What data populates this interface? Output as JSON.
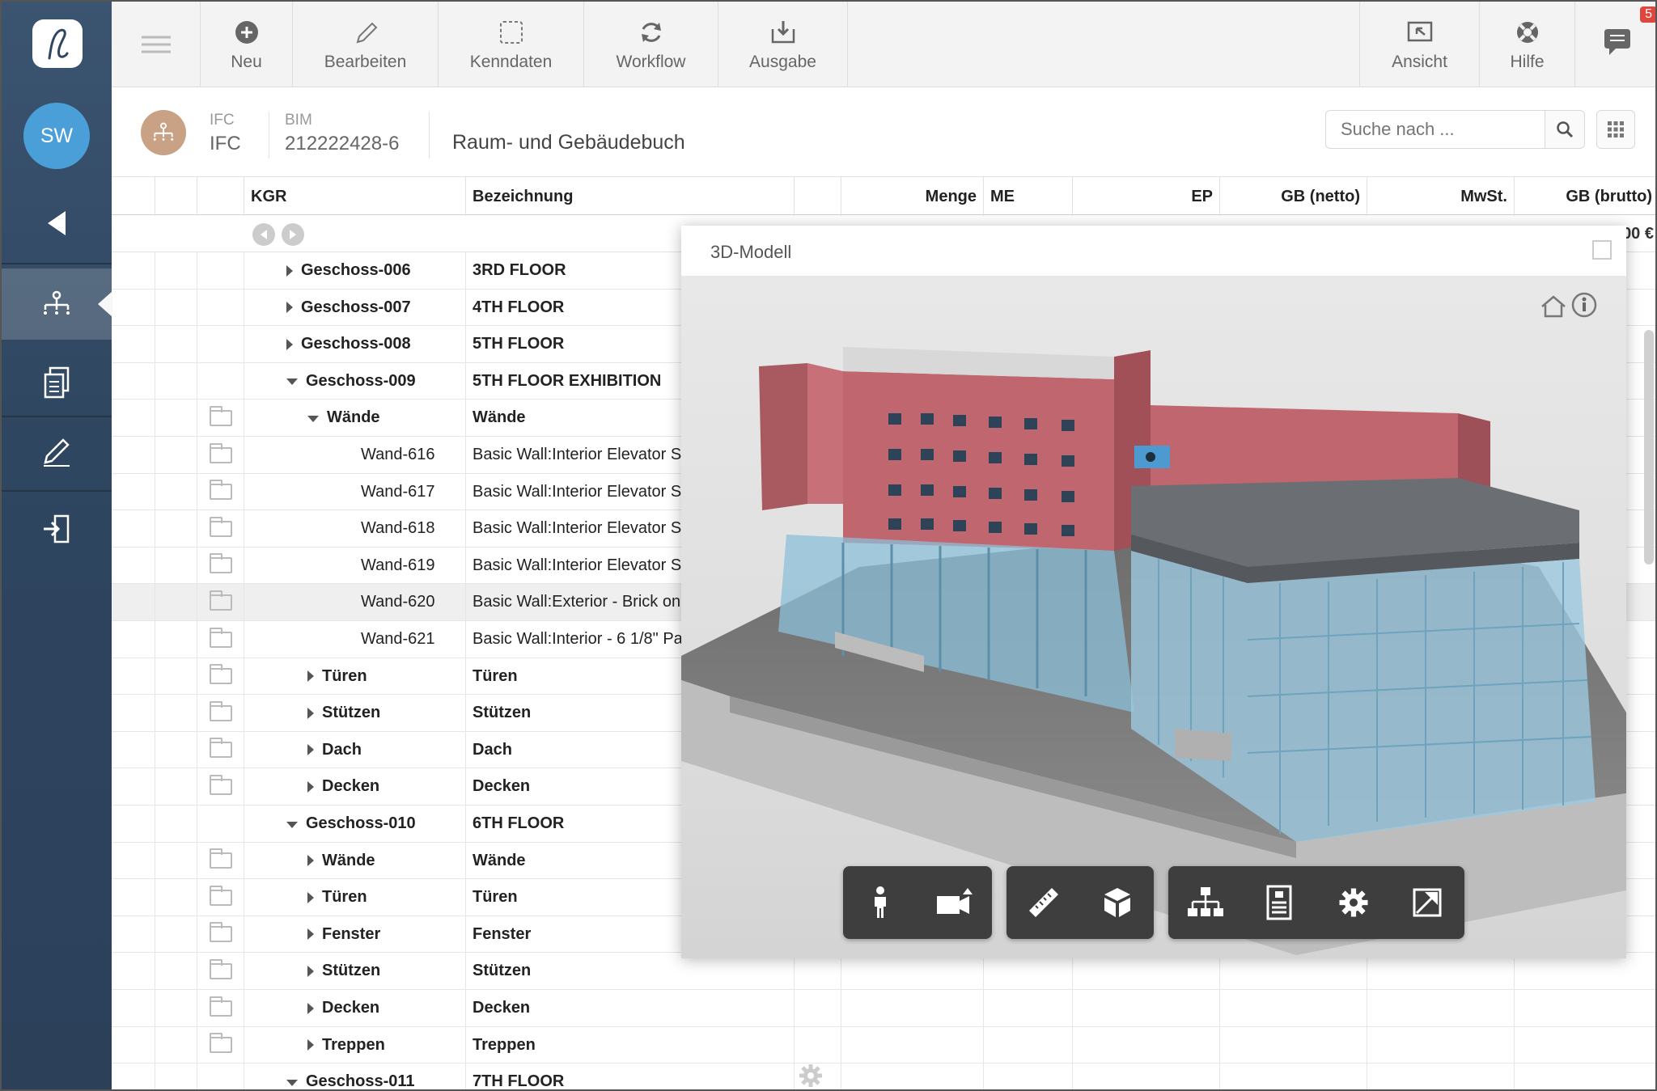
{
  "user": {
    "initials": "SW"
  },
  "toolbar": {
    "new": "Neu",
    "edit": "Bearbeiten",
    "keydata": "Kenndaten",
    "workflow": "Workflow",
    "output": "Ausgabe",
    "view": "Ansicht",
    "help": "Hilfe",
    "notifications": "5"
  },
  "header": {
    "type_label": "IFC",
    "type_value": "IFC",
    "bim_label": "BIM",
    "bim_value": "212222428-6",
    "title": "Raum- und Gebäudebuch",
    "search_placeholder": "Suche nach ..."
  },
  "columns": {
    "kgr": "KGR",
    "bezeichnung": "Bezeichnung",
    "menge": "Menge",
    "me": "ME",
    "ep": "EP",
    "gb_netto": "GB (netto)",
    "mwst": "MwSt.",
    "gb_brutto": "GB (brutto)"
  },
  "partial_total": "00 €",
  "rows": [
    {
      "kgr": "Geschoss-006",
      "bez": "3RD FLOOR"
    },
    {
      "kgr": "Geschoss-007",
      "bez": "4TH FLOOR"
    },
    {
      "kgr": "Geschoss-008",
      "bez": "5TH FLOOR"
    },
    {
      "kgr": "Geschoss-009",
      "bez": "5TH FLOOR EXHIBITION"
    },
    {
      "kgr": "Wände",
      "bez": "Wände"
    },
    {
      "kgr": "Wand-616",
      "bez": "Basic Wall:Interior Elevator S"
    },
    {
      "kgr": "Wand-617",
      "bez": "Basic Wall:Interior Elevator S"
    },
    {
      "kgr": "Wand-618",
      "bez": "Basic Wall:Interior Elevator S"
    },
    {
      "kgr": "Wand-619",
      "bez": "Basic Wall:Interior Elevator S"
    },
    {
      "kgr": "Wand-620",
      "bez": "Basic Wall:Exterior - Brick on"
    },
    {
      "kgr": "Wand-621",
      "bez": "Basic Wall:Interior - 6 1/8\" Pa"
    },
    {
      "kgr": "Türen",
      "bez": "Türen"
    },
    {
      "kgr": "Stützen",
      "bez": "Stützen"
    },
    {
      "kgr": "Dach",
      "bez": "Dach"
    },
    {
      "kgr": "Decken",
      "bez": "Decken"
    },
    {
      "kgr": "Geschoss-010",
      "bez": "6TH FLOOR"
    },
    {
      "kgr": "Wände",
      "bez": "Wände"
    },
    {
      "kgr": "Türen",
      "bez": "Türen"
    },
    {
      "kgr": "Fenster",
      "bez": "Fenster"
    },
    {
      "kgr": "Stützen",
      "bez": "Stützen"
    },
    {
      "kgr": "Decken",
      "bez": "Decken"
    },
    {
      "kgr": "Treppen",
      "bez": "Treppen"
    },
    {
      "kgr": "Geschoss-011",
      "bez": "7TH FLOOR"
    }
  ],
  "modal": {
    "title": "3D-Modell"
  },
  "colors": {
    "sidebar": "#2f4660",
    "accent": "#4a9fd8",
    "badge": "#e0453e",
    "brick": "#b4646a",
    "glass": "#8cbfd8"
  }
}
